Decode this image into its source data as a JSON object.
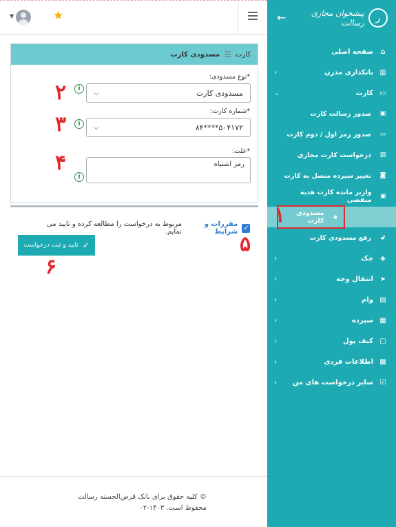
{
  "sidebar": {
    "title": "پیشخوان مجازی رسالت",
    "back_icon": "arrow-left-icon",
    "items": [
      {
        "label": "صفحه اصلی",
        "icon": "home-icon",
        "has_chevron": false
      },
      {
        "label": "بانکداری مدرن",
        "icon": "bank-icon",
        "has_chevron": true
      },
      {
        "label": "کارت",
        "icon": "card-icon",
        "has_chevron": true,
        "expanded": true
      }
    ],
    "card_subitems": [
      {
        "label": "صدور رسالت کارت",
        "icon": "briefcase-icon"
      },
      {
        "label": "صدور رمز اول / دوم کارت",
        "icon": "card-icon"
      },
      {
        "label": "درخواست کارت مجازی",
        "icon": "image-icon"
      },
      {
        "label": "تغییر سپرده متصل به کارت",
        "icon": "user-card-icon"
      },
      {
        "label": "واریز مانده کارت هدیه منقضی",
        "icon": "briefcase-icon"
      },
      {
        "label": "مسدودی کارت",
        "icon": "lock-icon",
        "active": true
      },
      {
        "label": "رفع مسدودی کارت",
        "icon": "unlock-icon"
      }
    ],
    "more_items": [
      {
        "label": "چک",
        "icon": "cheque-icon"
      },
      {
        "label": "انتقال وجه",
        "icon": "send-icon"
      },
      {
        "label": "وام",
        "icon": "loan-icon"
      },
      {
        "label": "سپرده",
        "icon": "deposit-icon"
      },
      {
        "label": "کیف پول",
        "icon": "wallet-icon"
      },
      {
        "label": "اطلاعات فردی",
        "icon": "id-card-icon"
      },
      {
        "label": "سایر درخواست های من",
        "icon": "checklist-icon"
      }
    ],
    "annotation_1": "۱"
  },
  "breadcrumb": {
    "root": "کارت",
    "current": "مسدودی کارت"
  },
  "form": {
    "block_type_label": "*نوع مسدودی:",
    "block_type_value": "مسدودی کارت",
    "card_number_label": "*شماره کارت:",
    "card_number_value": "۵۰۴۱۷۲****۸۴",
    "reason_label": "*علت:",
    "reason_value": "رمز اشتباه",
    "terms_link": "مقررات و شرایط",
    "terms_text": "مربوط به درخواست را مطالعه کرده و تایید می نمایم.",
    "submit_label": "تایید و ثبت درخواست"
  },
  "annotations": {
    "n2": "۲",
    "n3": "۳",
    "n4": "۴",
    "n5": "۵",
    "n6": "۶"
  },
  "footer": {
    "line1": "© کلیه حقوق برای بانک قرض‌الحسنه رسالت",
    "line2": "محفوظ است. ۱۴۰۳-۰۲"
  },
  "colors": {
    "brand": "#1daab3",
    "annotation_red": "#e3282b",
    "star": "#f4b400"
  }
}
